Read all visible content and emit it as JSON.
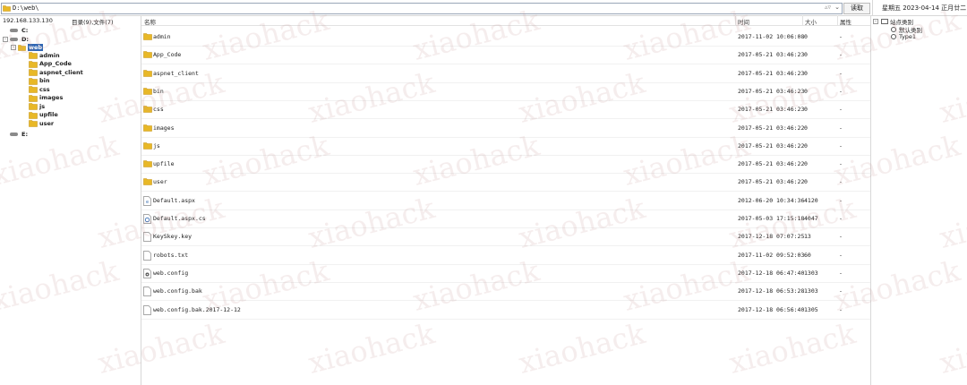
{
  "toolbar": {
    "path": "D:\\web\\",
    "read_label": "读取",
    "date_text": "星期五 2023-04-14 正月廿二"
  },
  "left_panel": {
    "ip": "192.168.133.130",
    "counts": "目录(9),文件(7)",
    "drives": [
      {
        "label": "C:",
        "expander": ""
      },
      {
        "label": "D:",
        "expander": "-"
      },
      {
        "label": "E:",
        "expander": ""
      }
    ],
    "selected_folder": {
      "label": "web",
      "expander": "-"
    },
    "subfolders": [
      "admin",
      "App_Code",
      "aspnet_client",
      "bin",
      "css",
      "images",
      "js",
      "upfile",
      "user"
    ]
  },
  "columns": {
    "name": "名称",
    "time": "时间",
    "size": "大小",
    "attr": "属性"
  },
  "files": [
    {
      "name": "admin",
      "time": "2017-11-02 10:06:08",
      "size": "0",
      "attr": "-",
      "icon": "folder"
    },
    {
      "name": "App_Code",
      "time": "2017-05-21 03:46:23",
      "size": "0",
      "attr": "-",
      "icon": "folder"
    },
    {
      "name": "aspnet_client",
      "time": "2017-05-21 03:46:23",
      "size": "0",
      "attr": "-",
      "icon": "folder"
    },
    {
      "name": "bin",
      "time": "2017-05-21 03:46:23",
      "size": "0",
      "attr": "-",
      "icon": "folder"
    },
    {
      "name": "css",
      "time": "2017-05-21 03:46:23",
      "size": "0",
      "attr": "-",
      "icon": "folder"
    },
    {
      "name": "images",
      "time": "2017-05-21 03:46:22",
      "size": "0",
      "attr": "-",
      "icon": "folder"
    },
    {
      "name": "js",
      "time": "2017-05-21 03:46:22",
      "size": "0",
      "attr": "-",
      "icon": "folder"
    },
    {
      "name": "upfile",
      "time": "2017-05-21 03:46:22",
      "size": "0",
      "attr": "-",
      "icon": "folder"
    },
    {
      "name": "user",
      "time": "2017-05-21 03:46:22",
      "size": "0",
      "attr": "-",
      "icon": "folder"
    },
    {
      "name": "Default.aspx",
      "time": "2012-06-20 10:34:36",
      "size": "4120",
      "attr": "-",
      "icon": "aspx"
    },
    {
      "name": "Default.aspx.cs",
      "time": "2017-05-03 17:15:18",
      "size": "4047",
      "attr": "-",
      "icon": "cs"
    },
    {
      "name": "KeySkey.key",
      "time": "2017-12-18 07:07:25",
      "size": "13",
      "attr": "-",
      "icon": "file"
    },
    {
      "name": "robots.txt",
      "time": "2017-11-02 09:52:03",
      "size": "60",
      "attr": "-",
      "icon": "file"
    },
    {
      "name": "web.config",
      "time": "2017-12-18 06:47:40",
      "size": "1303",
      "attr": "-",
      "icon": "config"
    },
    {
      "name": "web.config.bak",
      "time": "2017-12-18 06:53:28",
      "size": "1303",
      "attr": "-",
      "icon": "file"
    },
    {
      "name": "web.config.bak.2017-12-12",
      "time": "2017-12-18 06:56:40",
      "size": "1305",
      "attr": "-",
      "icon": "file"
    }
  ],
  "site_panel": {
    "root_label": "站点类别",
    "root_expander": "-",
    "items": [
      "默认类别",
      "Type1"
    ]
  },
  "watermark": "xiaohack",
  "colors": {
    "folder": "#e8b827",
    "folder_edge": "#c7961a",
    "selection": "#2f66b3",
    "watermark": "#c49696"
  }
}
